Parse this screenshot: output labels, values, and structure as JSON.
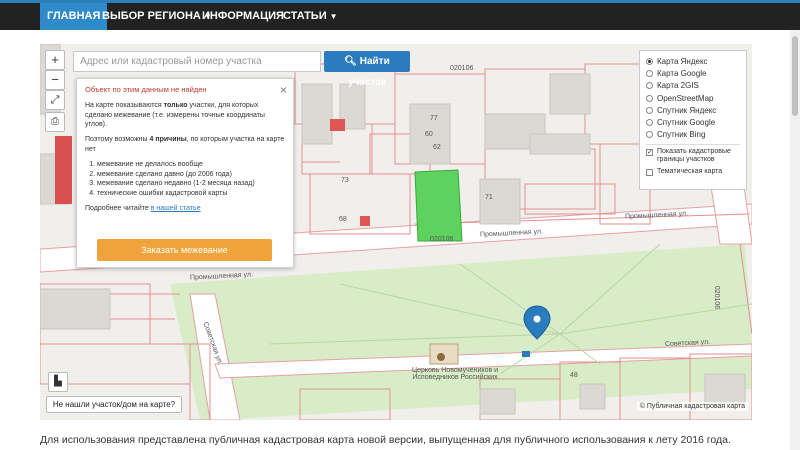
{
  "navbar": {
    "items": [
      "ГЛАВНАЯ",
      "ВЫБОР РЕГИОНА",
      "ИНФОРМАЦИЯ",
      "СТАТЬИ"
    ],
    "accent_color": "#2f8ac9"
  },
  "map_toolbar": {
    "zoom_in": "+",
    "zoom_out": "−",
    "search_placeholder": "Адрес или кадастровый номер участка",
    "search_button": "Найти участок",
    "search_icon": "search-icon"
  },
  "popup": {
    "title": "Объект по этим данным не найден",
    "intro_before": "На карте показываются ",
    "intro_bold": "только",
    "intro_after": " участки, для которых сделано межевание (т.е. измерены точные координаты углов).",
    "reasons_before": "Поэтому возможны ",
    "reasons_bold": "4 причины",
    "reasons_after": ", по которым участка на карте нет",
    "reasons": [
      "межевание не делалось вообще",
      "межевание сделано давно (до 2006 года)",
      "межевание сделано недавно (1-2 месяца назад)",
      "технические ошибки кадастровой карты"
    ],
    "more_text": "Подробнее читайте ",
    "more_link": "в нашей статье",
    "order_button": "Заказать межевание",
    "order_color": "#f0a33a"
  },
  "layers": {
    "options": [
      "Карта Яндекс",
      "Карта Google",
      "Карта 2GIS",
      "OpenStreetMap",
      "Спутник Яндекс",
      "Спутник Google",
      "Спутник Bing"
    ],
    "selected": "Карта Яндекс",
    "show_borders": "Показать кадастровые границы участков",
    "show_borders_checked": true,
    "thematic": "Тематическая карта",
    "thematic_checked": false
  },
  "map": {
    "not_found_button": "Не нашли участок/дом на карте?",
    "attribution": "© Публичная кадастровая карта",
    "labels": {
      "street1": "Промышленная ул.",
      "street2": "Промышленная ул.",
      "street3": "Промышленная ул.",
      "street4": "Советская ул.",
      "street5": "Советская ул.",
      "quarter1": "020106",
      "quarter2": "020106",
      "quarter3": "020106",
      "church": "Церковь Новомучеников и Исповедников Российских",
      "num1": "77",
      "num2": "60",
      "num3": "62",
      "num4": "73",
      "num5": "68",
      "num6": "71",
      "num7": "48"
    }
  },
  "footer": {
    "text": "Для использования представлена публичная кадастровая карта новой версии, выпущенная для публичного использования к лету 2016 года."
  }
}
